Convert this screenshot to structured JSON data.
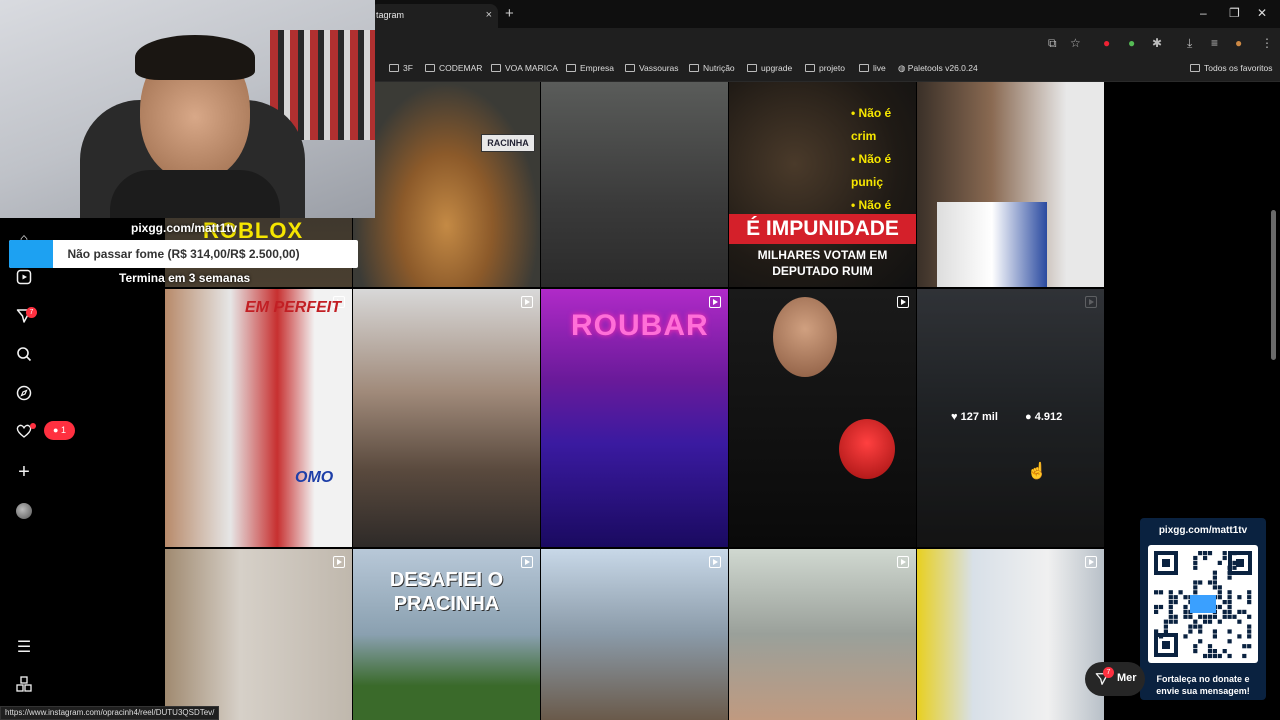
{
  "browser": {
    "tab_title": "tagram",
    "close_glyph": "×",
    "newtab_glyph": "+",
    "window_controls": [
      "–",
      "❐",
      "✕"
    ],
    "bookmarks": [
      "3F",
      "CODEMAR",
      "VOA MARICA",
      "Empresa",
      "Vassouras",
      "Nutrição",
      "upgrade",
      "projeto",
      "live",
      "Paletools v26.0.24"
    ],
    "all_bookmarks": "Todos os favoritos",
    "status_url": "https://www.instagram.com/opracinh4/reel/DUTU3QSDTev/"
  },
  "sidebar": {
    "messages_badge": "7",
    "notifications_badge": "1",
    "icons": [
      "home-icon",
      "reels-icon",
      "messages-icon",
      "search-icon",
      "explore-icon",
      "notifications-icon",
      "create-icon",
      "profile-avatar",
      "menu-icon",
      "more-apps-icon"
    ]
  },
  "grid": {
    "tile_texts": {
      "roblox": "ROBLOX",
      "impunidade": "É IMPUNIDADE",
      "milhares": "MILHARES VOTAM EM",
      "deputado": "DEPUTADO RUIM",
      "bullet1": "• Não é crim",
      "bullet2": "• Não é puniç",
      "bullet3": "• Não é justiç",
      "roubar": "ROUBAR",
      "desafiei1": "DESAFIEI O",
      "desafiei2": "PRACINHA",
      "perfeit": "EM PERFEIT",
      "omo": "OMO",
      "plate": "RACINHA"
    },
    "hover": {
      "likes": "127 mil",
      "comments": "4.912"
    }
  },
  "overlay": {
    "goal_link": "pixgg.com/matt1tv",
    "goal_label": "Não passar fome (R$ 314,00/R$ 2.500,00)",
    "goal_progress": 0.1256,
    "goal_remaining": "Termina em 3 semanas",
    "qr_title": "pixgg.com/matt1tv",
    "qr_footer_line1": "Fortaleça no donate e",
    "qr_footer_line2": "envie sua mensagem!",
    "msg_badge": "7",
    "msg_label": "Mer"
  },
  "colors": {
    "instagram_red": "#ff3040",
    "goal_fill": "#1da1f2",
    "qr_panel": "#0a2240"
  }
}
